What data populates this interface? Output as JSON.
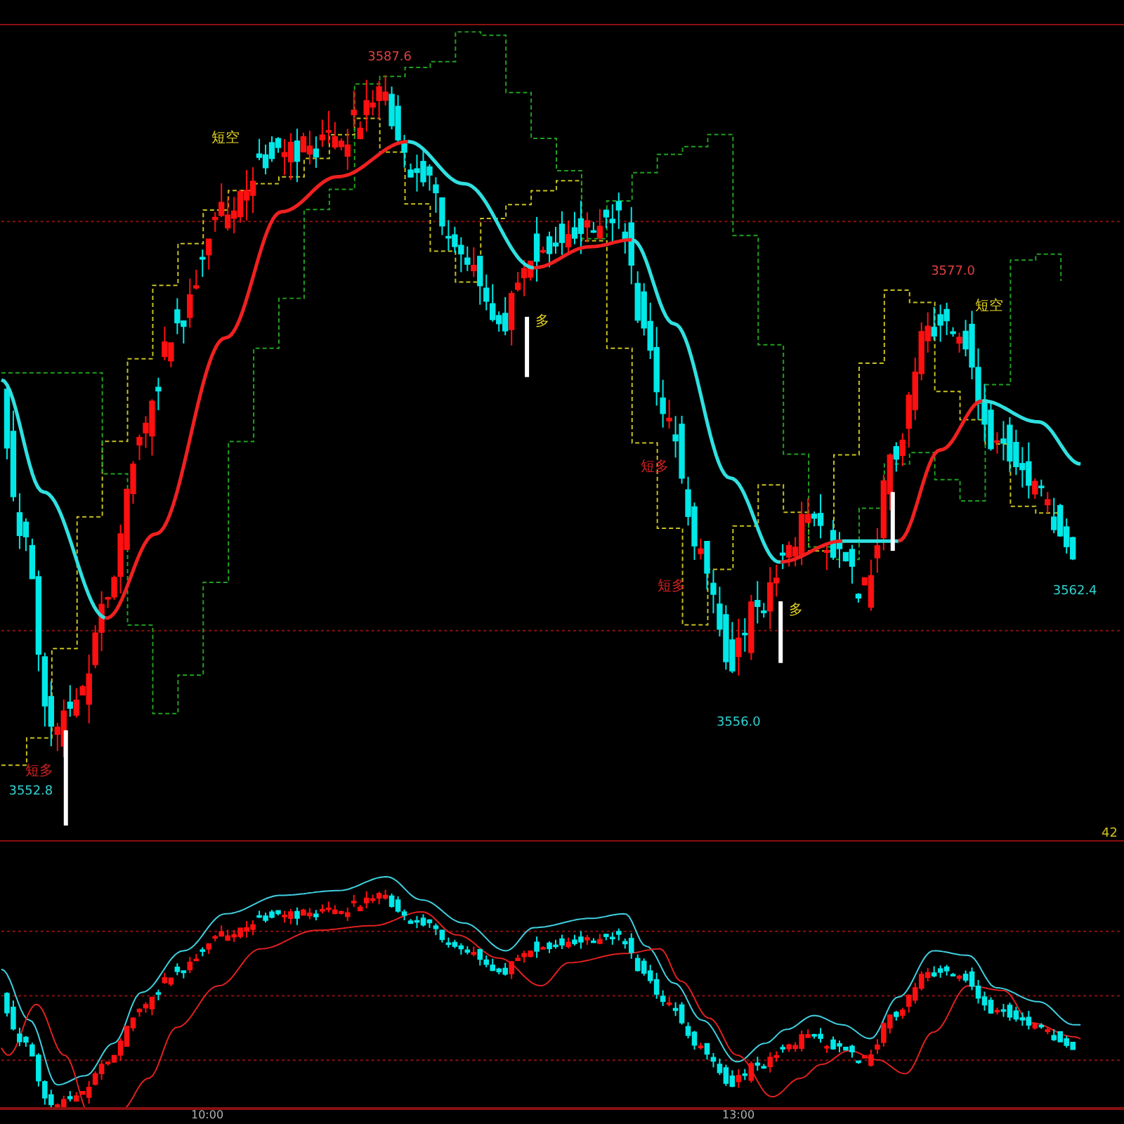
{
  "main_chart": {
    "annotations": [
      {
        "kind": "high",
        "text": "3587.6"
      },
      {
        "kind": "high",
        "text": "3577.0"
      },
      {
        "kind": "low",
        "text": "3556.0"
      },
      {
        "kind": "low",
        "text": "3552.8"
      },
      {
        "kind": "low",
        "text": "3562.4"
      },
      {
        "kind": "signal",
        "text": "短空",
        "color": "#e0d020"
      },
      {
        "kind": "signal",
        "text": "短空",
        "color": "#e0d020"
      },
      {
        "kind": "signal",
        "text": "短多",
        "color": "#d02020"
      },
      {
        "kind": "signal",
        "text": "短多",
        "color": "#d02020"
      },
      {
        "kind": "signal",
        "text": "短多",
        "color": "#d02020"
      },
      {
        "kind": "signal",
        "text": "多",
        "color": "#e0d020"
      },
      {
        "kind": "signal",
        "text": "多",
        "color": "#e0d020"
      }
    ],
    "edge_label": "42"
  },
  "time_axis": [
    "10:00",
    "13:00"
  ]
}
